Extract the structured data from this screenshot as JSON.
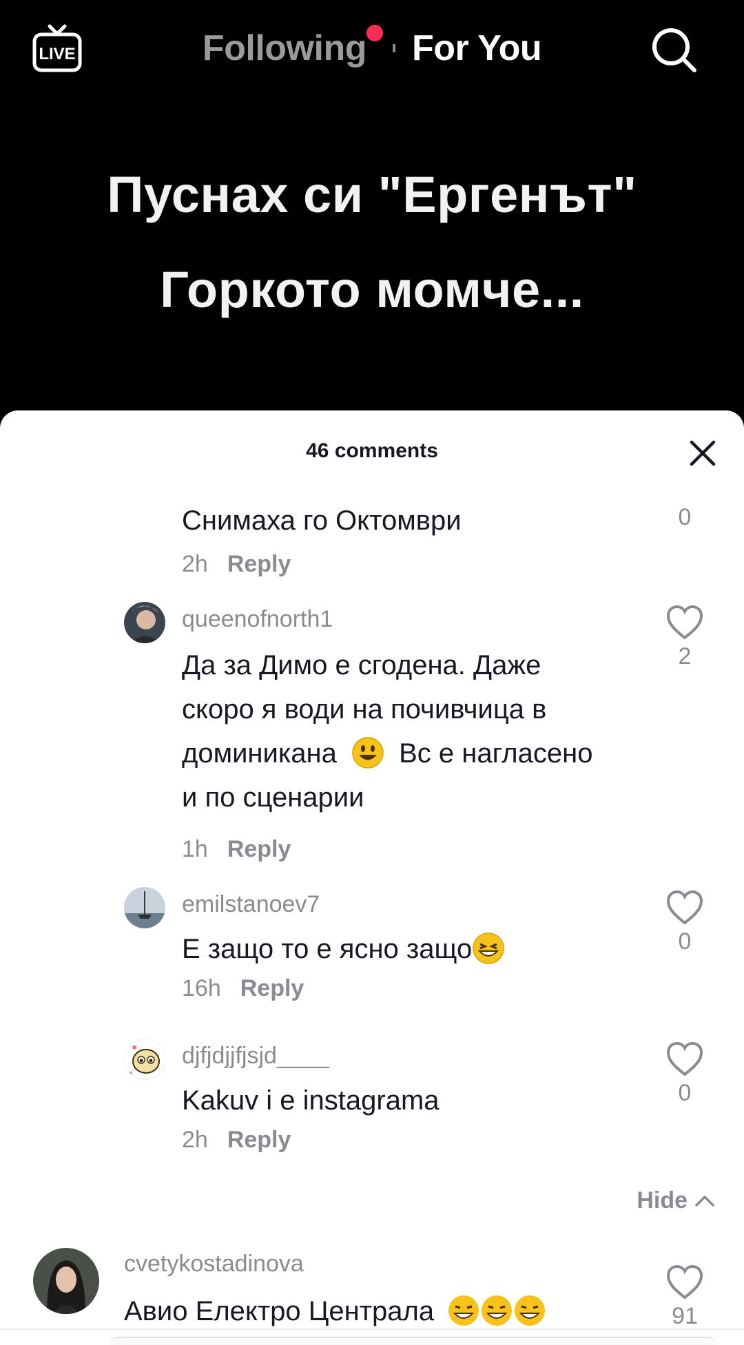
{
  "topbar": {
    "live_label": "LIVE",
    "following_label": "Following",
    "for_you_label": "For You"
  },
  "video": {
    "caption_line_1": "Пуснах си \"Ергенът\"",
    "caption_line_2": "Горкото момче..."
  },
  "comments_sheet": {
    "title": "46 comments",
    "hide_label": "Hide",
    "comments": [
      {
        "username": "",
        "text": "Снимаха го Октомври",
        "time": "2h",
        "reply_label": "Reply",
        "likes": "0"
      },
      {
        "username": "queenofnorth1",
        "text_lines": [
          "Да за Димо е сгодена. Даже",
          "скоро я води на почивчица в",
          "доминикана",
          "Вс е нагласено",
          "и по сценарии"
        ],
        "time": "1h",
        "reply_label": "Reply",
        "likes": "2"
      },
      {
        "username": "emilstanoev7",
        "text": "Е защо то е ясно защо",
        "time": "16h",
        "reply_label": "Reply",
        "likes": "0"
      },
      {
        "username": "djfjdjjfjsjd____",
        "text": "Kakuv i e instagrama",
        "time": "2h",
        "reply_label": "Reply",
        "likes": "0"
      },
      {
        "username": "cvetykostadinova",
        "text": "Авио Електро Централа",
        "likes": "91"
      }
    ]
  },
  "colors": {
    "accent_red": "#fe2c55",
    "muted_text": "#8a8b91",
    "primary_text": "#161823"
  }
}
